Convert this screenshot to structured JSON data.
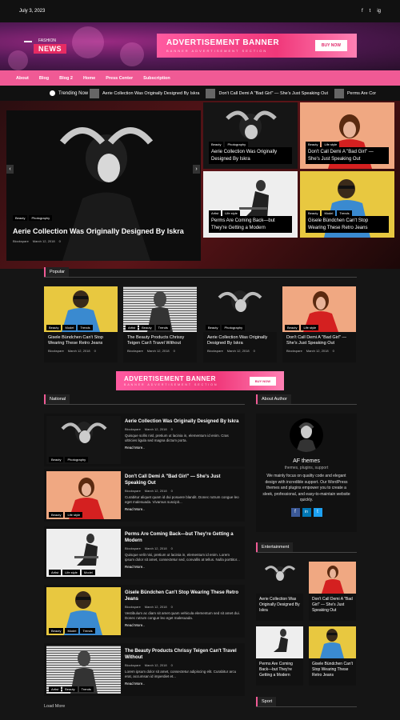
{
  "topbar": {
    "date": "July 3, 2023",
    "social": [
      "f",
      "t",
      "ig"
    ]
  },
  "logo": {
    "top": "FASHION",
    "main": "NEWS"
  },
  "ad": {
    "title": "ADVERTISEMENT BANNER",
    "subtitle": "BANNER ADVERTISEMENT SECTION",
    "button": "BUY NOW"
  },
  "nav": [
    "About",
    "Blog",
    "Blog 2",
    "Home",
    "Press Center",
    "Subscription"
  ],
  "trending": {
    "label": "Trending Now",
    "items": [
      "Aerie Collection Was Originally Designed By Iskra",
      "Don't Call Demi A \"Bad Girl\" — She's Just Speaking Out",
      "Perms Are Cor"
    ]
  },
  "hero": {
    "main": {
      "tags": [
        "Beauty",
        "Photography"
      ],
      "title": "Aerie Collection Was Originally Designed By Iskra",
      "author": "Blockspare",
      "date": "March 12, 2018",
      "comments": "0"
    },
    "grid": [
      {
        "tags": [
          "Beauty",
          "Photography"
        ],
        "title": "Aerie Collection Was Originally Designed By Iskra"
      },
      {
        "tags": [
          "Beauty",
          "Life style"
        ],
        "title": "Don't Call Demi A \"Bad Girl\" — She's Just Speaking Out"
      },
      {
        "tags": [
          "Artist",
          "Life style"
        ],
        "title": "Perms Are Coming Back—but They're Getting a Modern"
      },
      {
        "tags": [
          "Beauty",
          "Model",
          "Trends"
        ],
        "title": "Gisele Bündchen Can't Stop Wearing These Retro Jeans"
      }
    ]
  },
  "popular": {
    "heading": "Popular",
    "cards": [
      {
        "tags": [
          "Beauty",
          "Model",
          "Trends"
        ],
        "title": "Gisele Bündchen Can't Stop Wearing These Retro Jeans",
        "author": "Blockspare",
        "date": "March 12, 2018",
        "comments": "0"
      },
      {
        "tags": [
          "Artist",
          "Beauty",
          "Trends"
        ],
        "title": "The Beauty Products Chrissy Teigen Can't Travel Without",
        "author": "Blockspare",
        "date": "March 12, 2018",
        "comments": "0"
      },
      {
        "tags": [
          "Beauty",
          "Photography"
        ],
        "title": "Aerie Collection Was Originally Designed By Iskra",
        "author": "Blockspare",
        "date": "March 12, 2018",
        "comments": "0"
      },
      {
        "tags": [
          "Beauty",
          "Life style"
        ],
        "title": "Don't Call Demi A \"Bad Girl\" — She's Just Speaking Out",
        "author": "Blockspare",
        "date": "March 12, 2018",
        "comments": "0"
      }
    ]
  },
  "national": {
    "heading": "National",
    "cards": [
      {
        "tags": [
          "Beauty",
          "Photography"
        ],
        "title": "Aerie Collection Was Originally Designed By Iskra",
        "author": "Blockspare",
        "date": "March 12, 2018",
        "comments": "0",
        "excerpt": "Quisque sollis nisl, pretium ut lacinia in, elementum id enim. Cras ultricies ligula sed magna dictum porta.",
        "more": "Read More.."
      },
      {
        "tags": [
          "Beauty",
          "Life style"
        ],
        "title": "Don't Call Demi A \"Bad Girl\" — She's Just Speaking Out",
        "author": "Blockspare",
        "date": "March 12, 2018",
        "comments": "0",
        "excerpt": "Curabitur aliquet quam id dui posuere blandit. Donec rutrum congue leo eget malesuada. Vivamus suscipit...",
        "more": "Read More.."
      },
      {
        "tags": [
          "Artist",
          "Life style",
          "Model"
        ],
        "title": "Perms Are Coming Back—but They're Getting a Modern",
        "author": "Blockspare",
        "date": "March 12, 2018",
        "comments": "0",
        "excerpt": "Quisque velit nisi, pretium ut lacinia in, elementum id enim. Lorem ipsum dolor sit amet, consectetur sed, convallis at tellus. Nulla porttitor...",
        "more": "Read More.."
      },
      {
        "tags": [
          "Beauty",
          "Model",
          "Trends"
        ],
        "title": "Gisele Bündchen Can't Stop Wearing These Retro Jeans",
        "author": "Blockspare",
        "date": "March 12, 2018",
        "comments": "0",
        "excerpt": "Vestibulum ac diam sit amet quam vehicula elementum sed sit amet dui. Donec rutrum congue leo eget malesuada.",
        "more": "Read More.."
      },
      {
        "tags": [
          "Artist",
          "Beauty",
          "Trends"
        ],
        "title": "The Beauty Products Chrissy Teigen Can't Travel Without",
        "author": "Blockspare",
        "date": "March 12, 2018",
        "comments": "0",
        "excerpt": "Lorem ipsum dolor sit amet, consectetur adipiscing elit. Curabitur arcu erat, accumsan id imperdiet et...",
        "more": "Read More.."
      }
    ],
    "load_more": "Load More"
  },
  "about": {
    "heading": "About Author",
    "name": "AF themes",
    "tagline": "themes, plugins, support",
    "bio": "We mainly focus on quality code and elegant design with incredible support. Our WordPress themes and plugins empower you to create a sleek, professional, and easy-to-maintain website quickly.",
    "social": [
      "f",
      "in",
      "t"
    ]
  },
  "entertainment": {
    "heading": "Entertainment",
    "cards": [
      {
        "title": "Aerie Collection Was Originally Designed By Iskra"
      },
      {
        "title": "Don't Call Demi A \"Bad Girl\" — She's Just Speaking Out"
      },
      {
        "title": "Perms Are Coming Back—but They're Getting a Modern"
      },
      {
        "title": "Gisele Bündchen Can't Stop Wearing These Retro Jeans"
      }
    ]
  },
  "sport": {
    "heading": "Sport"
  },
  "colors": {
    "accent": "#f05a95",
    "bg": "#151515",
    "card": "#111111"
  }
}
